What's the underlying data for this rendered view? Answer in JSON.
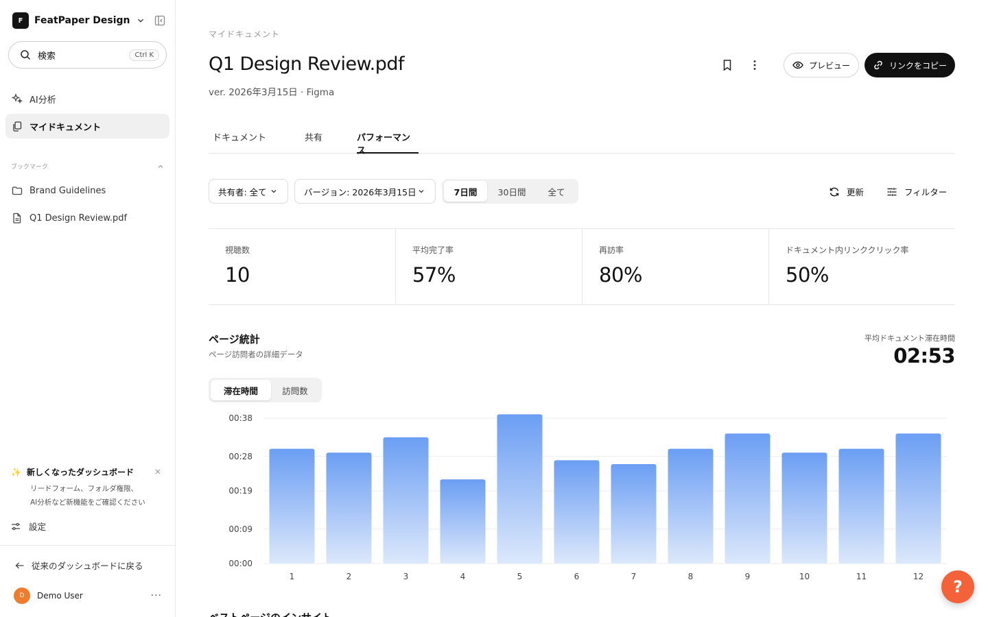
{
  "sidebar": {
    "workspace": {
      "logo_letter": "F",
      "name": "FeatPaper Design"
    },
    "search": {
      "placeholder": "検索",
      "shortcut": "Ctrl K"
    },
    "nav": [
      {
        "label": "AI分析",
        "icon": "sparkles-icon",
        "active": false
      },
      {
        "label": "マイドキュメント",
        "icon": "documents-icon",
        "active": true
      }
    ],
    "bookmarks": {
      "title": "ブックマーク",
      "items": [
        {
          "label": "Brand Guidelines",
          "icon": "folder-icon"
        },
        {
          "label": "Q1 Design Review.pdf",
          "icon": "file-icon"
        }
      ]
    },
    "notice": {
      "icon": "✨",
      "title": "新しくなったダッシュボード",
      "line1": "リードフォーム、フォルダ権限、",
      "line2": "AI分析など新機能をご確認ください"
    },
    "settings_label": "設定",
    "back_label": "従来のダッシュボードに戻る",
    "user": {
      "initial": "D",
      "name": "Demo User",
      "more": "···"
    }
  },
  "header": {
    "breadcrumb": "マイドキュメント",
    "title": "Q1 Design Review.pdf",
    "meta": "ver. 2026年3月15日 · Figma",
    "preview_label": "プレビュー",
    "copy_link_label": "リンクをコピー"
  },
  "tabs": [
    {
      "label": "ドキュメント",
      "active": false
    },
    {
      "label": "共有",
      "active": false
    },
    {
      "label": "パフォーマンス",
      "active": true
    }
  ],
  "filters": {
    "sharer": "共有者: 全て",
    "version": "バージョン: 2026年3月15日",
    "periods": [
      {
        "label": "7日間",
        "active": true
      },
      {
        "label": "30日間",
        "active": false
      },
      {
        "label": "全て",
        "active": false
      }
    ],
    "refresh_label": "更新",
    "filter_label": "フィルター"
  },
  "stats": [
    {
      "label": "視聴数",
      "value": "10"
    },
    {
      "label": "平均完了率",
      "value": "57%"
    },
    {
      "label": "再訪率",
      "value": "80%"
    },
    {
      "label": "ドキュメント内リンククリック率",
      "value": "50%"
    }
  ],
  "page_stats": {
    "title": "ページ統計",
    "subtitle": "ページ訪問者の詳細データ",
    "avg_label": "平均ドキュメント滞在時間",
    "avg_value": "02:53",
    "toggle": [
      {
        "label": "滞在時間",
        "active": true
      },
      {
        "label": "訪問数",
        "active": false
      }
    ]
  },
  "chart_data": {
    "type": "bar",
    "categories": [
      "1",
      "2",
      "3",
      "4",
      "5",
      "6",
      "7",
      "8",
      "9",
      "10",
      "11",
      "12"
    ],
    "values_seconds": [
      30,
      29,
      33,
      22,
      39,
      27,
      26,
      30,
      34,
      29,
      30,
      34
    ],
    "ylim_seconds": [
      0,
      38
    ],
    "y_ticks": [
      "00:00",
      "00:09",
      "00:19",
      "00:28",
      "00:38"
    ],
    "y_tick_seconds": [
      0,
      9,
      19,
      28,
      38
    ],
    "grid": true,
    "bar_color_top": "#6b9ef3",
    "bar_color_bottom": "#dce8fb"
  },
  "next_section_title": "ベストページのインサイト",
  "help_label": "?",
  "colors": {
    "accent_dark": "#111111",
    "help": "#f4623a",
    "avatar": "#f07b2c"
  }
}
